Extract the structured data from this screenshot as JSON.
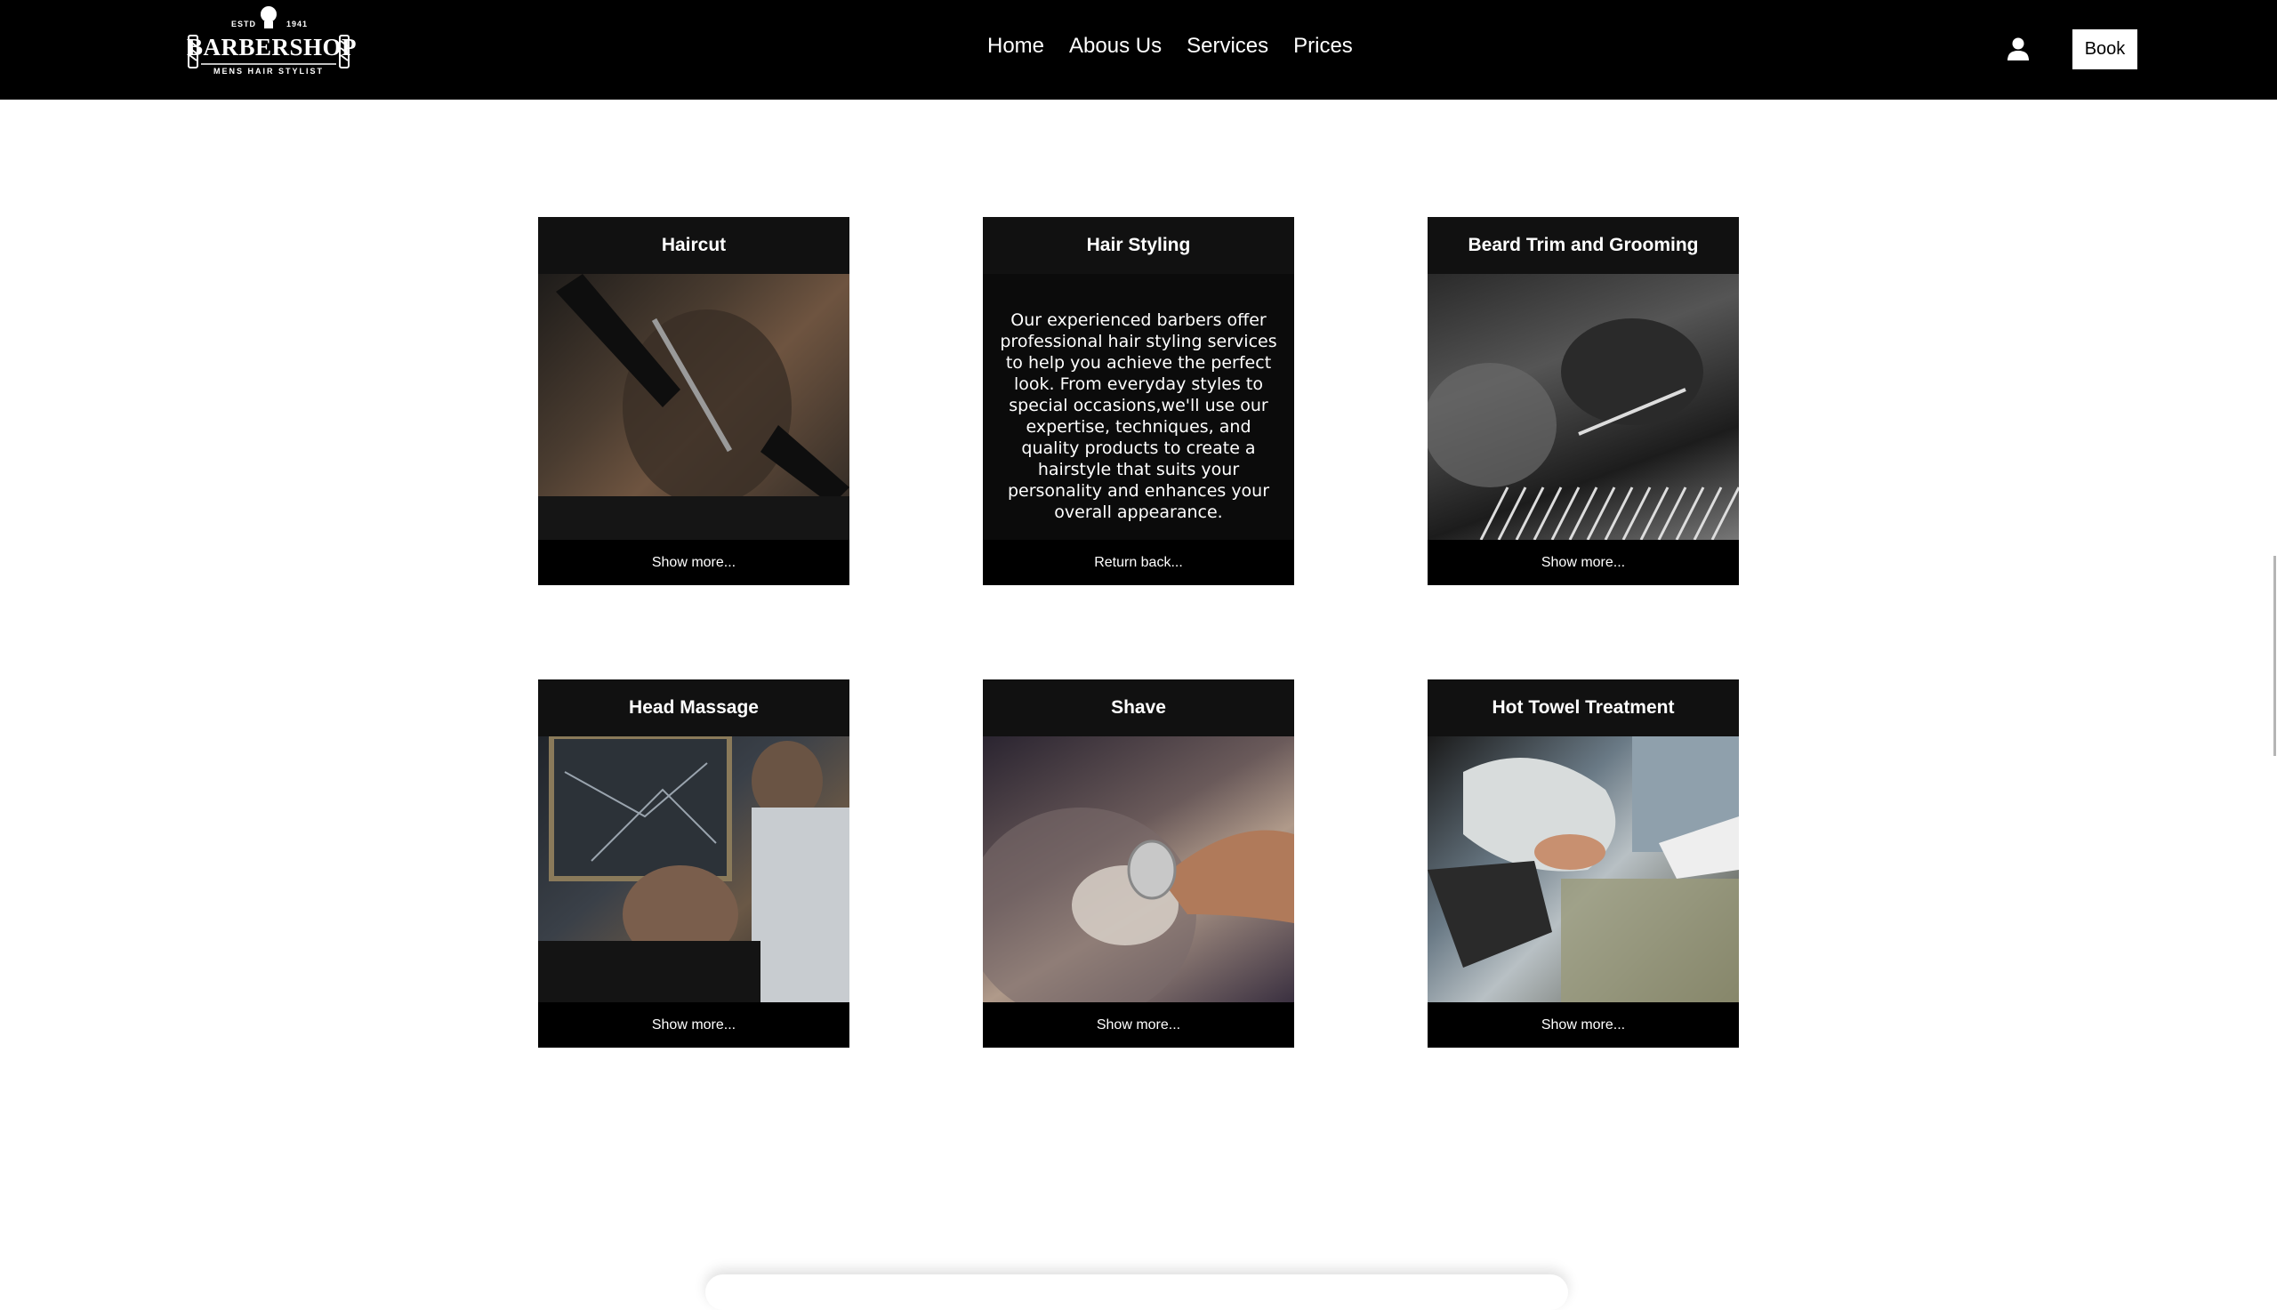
{
  "brand": {
    "estd": "ESTD",
    "year": "1941",
    "name": "BARBERSHOP",
    "tagline": "MENS HAIR STYLIST"
  },
  "nav": [
    "Home",
    "Abous Us",
    "Services",
    "Prices"
  ],
  "header": {
    "user_icon": "user-icon",
    "book_label": "Book"
  },
  "cards": [
    {
      "title": "Haircut",
      "link": "Show more...",
      "image": "haircut-photo"
    },
    {
      "title": "Hair Styling",
      "description": "Our experienced barbers offer professional hair styling services to help you achieve the perfect look. From everyday styles to special occasions,we'll use our expertise, techniques, and quality products to create a hairstyle that suits your personality and enhances your overall appearance.",
      "link": "Return back..."
    },
    {
      "title": "Beard Trim and Grooming",
      "link": "Show more...",
      "image": "beard-trim-photo"
    },
    {
      "title": "Head Massage",
      "link": "Show more...",
      "image": "head-massage-photo"
    },
    {
      "title": "Shave",
      "link": "Show more...",
      "image": "shave-photo"
    },
    {
      "title": "Hot Towel Treatment",
      "link": "Show more...",
      "image": "hot-towel-photo"
    }
  ],
  "colors": {
    "header_bg": "#000000",
    "card_bg": "#111111",
    "page_bg": "#ffffff"
  }
}
